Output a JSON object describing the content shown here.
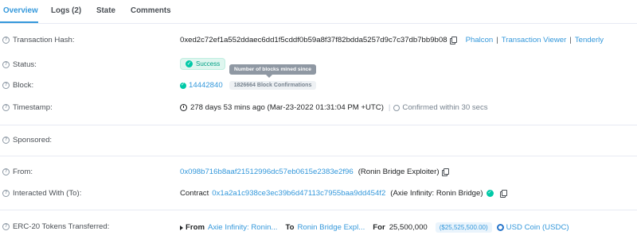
{
  "tabs": [
    {
      "label": "Overview"
    },
    {
      "label": "Logs (2)"
    },
    {
      "label": "State"
    },
    {
      "label": "Comments"
    }
  ],
  "tx_hash": {
    "label": "Transaction Hash:",
    "value": "0xed2c72ef1a552ddaec6dd1f5cddf0b59a8f37f82bdda5257d9c7c37db7bb9b08",
    "links": [
      "Phalcon",
      "Transaction Viewer",
      "Tenderly"
    ]
  },
  "status": {
    "label": "Status:",
    "value": "Success"
  },
  "block": {
    "label": "Block:",
    "number": "14442840",
    "confirmations": "1826664 Block Confirmations",
    "tooltip": "Number of blocks mined since"
  },
  "timestamp": {
    "label": "Timestamp:",
    "value": "278 days 53 mins ago (Mar-23-2022 01:31:04 PM +UTC)",
    "confirmed": "Confirmed within 30 secs"
  },
  "sponsored": {
    "label": "Sponsored:"
  },
  "from": {
    "label": "From:",
    "address": "0x098b716b8aaf21512996dc57eb0615e2383e2f96",
    "name": "(Ronin Bridge Exploiter)"
  },
  "interacted": {
    "label": "Interacted With (To):",
    "prefix": "Contract",
    "address": "0x1a2a1c938ce3ec39b6d47113c7955baa9dd454f2",
    "name": "(Axie Infinity: Ronin Bridge)"
  },
  "erc20": {
    "label": "ERC-20 Tokens Transferred:",
    "from_label": "From",
    "from_value": "Axie Infinity: Ronin...",
    "to_label": "To",
    "to_value": "Ronin Bridge Expl...",
    "for_label": "For",
    "amount": "25,500,000",
    "usd": "($25,525,500.00)",
    "token": "USD Coin (USDC)"
  },
  "colors": {
    "accent": "#3498db",
    "success": "#00c9a7"
  }
}
